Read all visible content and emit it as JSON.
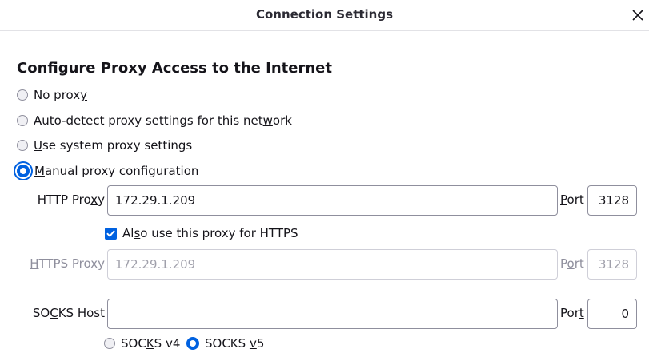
{
  "dialog": {
    "title": "Connection Settings",
    "close_icon": "close-icon"
  },
  "section": {
    "heading": "Configure Proxy Access to the Internet"
  },
  "proxy_options": [
    {
      "pre": "No prox",
      "key": "y",
      "post": "",
      "checked": false
    },
    {
      "pre": "Auto-detect proxy settings for this net",
      "key": "w",
      "post": "ork",
      "checked": false
    },
    {
      "pre": "",
      "key": "U",
      "post": "se system proxy settings",
      "checked": false
    },
    {
      "pre": "",
      "key": "M",
      "post": "anual proxy configuration",
      "checked": true
    }
  ],
  "http": {
    "label_pre": "HTTP Pro",
    "label_key": "x",
    "label_post": "y",
    "value": "172.29.1.209",
    "port_label_key": "P",
    "port_label_post": "ort",
    "port_value": "3128"
  },
  "also_https": {
    "label_pre": "Al",
    "label_key": "s",
    "label_post": "o use this proxy for HTTPS",
    "checked": true
  },
  "https": {
    "label_pre": "",
    "label_key": "H",
    "label_post": "TTPS Proxy",
    "value": "172.29.1.209",
    "port_label_pre": "P",
    "port_label_key": "o",
    "port_label_post": "rt",
    "port_value": "3128",
    "disabled": true
  },
  "socks": {
    "label_pre": "SO",
    "label_key": "C",
    "label_post": "KS Host",
    "value": "",
    "port_label_pre": "Por",
    "port_label_key": "t",
    "port_label_post": "",
    "port_value": "0",
    "versions": [
      {
        "pre": "SOC",
        "key": "K",
        "post": "S v4",
        "checked": false
      },
      {
        "pre": "SOCKS ",
        "key": "v",
        "post": "5",
        "checked": true
      }
    ]
  },
  "colors": {
    "accent": "#0061e0",
    "text": "#15141a",
    "disabled_text": "#8f8f9d",
    "border": "#8f8f9d"
  }
}
